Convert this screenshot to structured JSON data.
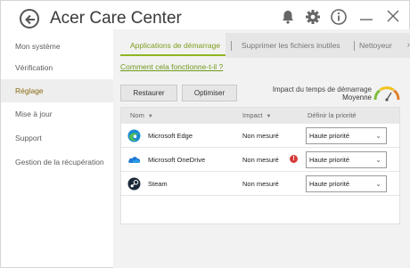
{
  "app": {
    "title": "Acer Care Center"
  },
  "sidebar": {
    "items": [
      {
        "label": "Mon système",
        "active": false
      },
      {
        "label": "Vérification",
        "active": false
      },
      {
        "label": "Réglage",
        "active": true
      },
      {
        "label": "Mise à jour",
        "active": false
      },
      {
        "label": "Support",
        "active": false
      },
      {
        "label": "Gestion de la récupération",
        "active": false
      }
    ]
  },
  "tabs": [
    {
      "label": "Applications de démarrage",
      "active": true
    },
    {
      "label": "Supprimer les fichiers inutiles",
      "active": false
    },
    {
      "label": "Nettoyeur",
      "active": false
    }
  ],
  "help_link": "Comment cela fonctionne-t-il ?",
  "buttons": {
    "restore": "Restaurer",
    "optimize": "Optimiser"
  },
  "impact": {
    "label": "Impact du temps de démarrage",
    "value": "Moyenne"
  },
  "table": {
    "columns": {
      "name": "Nom",
      "impact": "Impact",
      "priority": "Définir la priorité"
    },
    "rows": [
      {
        "name": "Microsoft Edge",
        "impact": "Non mesuré",
        "priority": "Haute priorité",
        "icon": "edge-icon",
        "warning": false
      },
      {
        "name": "Microsoft OneDrive",
        "impact": "Non mesuré",
        "priority": "Haute priorité",
        "icon": "onedrive-icon",
        "warning": true
      },
      {
        "name": "Steam",
        "impact": "Non mesuré",
        "priority": "Haute priorité",
        "icon": "steam-icon",
        "warning": false
      }
    ]
  },
  "colors": {
    "accent": "#8eb521",
    "link": "#6f9a1e",
    "active_side": "#8a6a10",
    "warning": "#d63b3b"
  }
}
